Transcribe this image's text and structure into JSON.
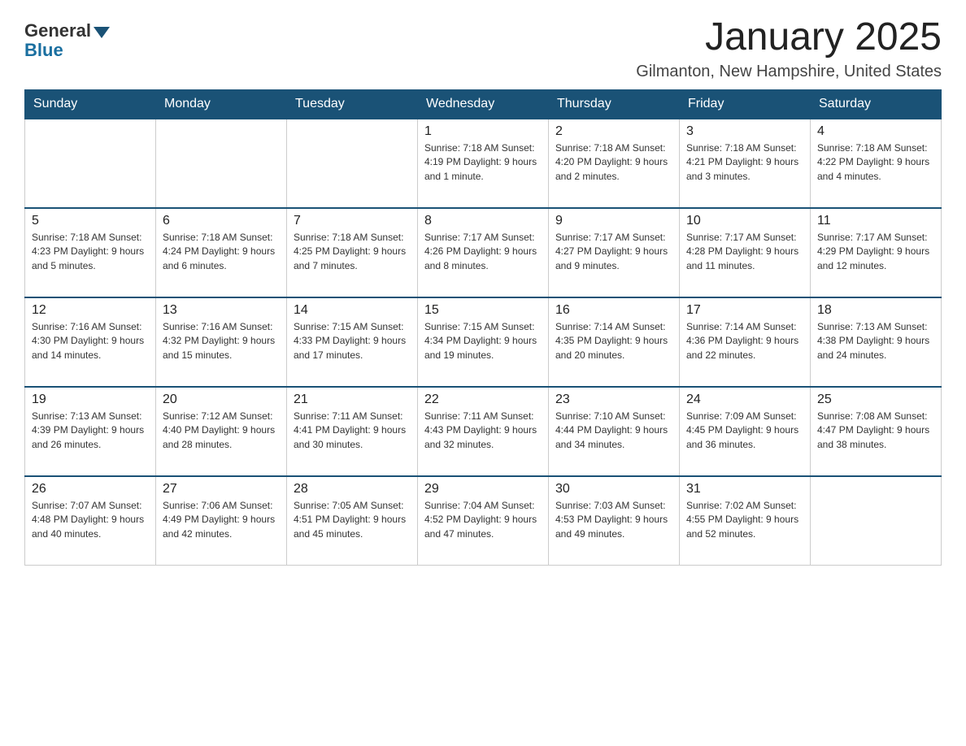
{
  "header": {
    "logo": {
      "general": "General",
      "blue": "Blue"
    },
    "title": "January 2025",
    "location": "Gilmanton, New Hampshire, United States"
  },
  "weekdays": [
    "Sunday",
    "Monday",
    "Tuesday",
    "Wednesday",
    "Thursday",
    "Friday",
    "Saturday"
  ],
  "weeks": [
    [
      {
        "day": "",
        "info": ""
      },
      {
        "day": "",
        "info": ""
      },
      {
        "day": "",
        "info": ""
      },
      {
        "day": "1",
        "info": "Sunrise: 7:18 AM\nSunset: 4:19 PM\nDaylight: 9 hours and 1 minute."
      },
      {
        "day": "2",
        "info": "Sunrise: 7:18 AM\nSunset: 4:20 PM\nDaylight: 9 hours and 2 minutes."
      },
      {
        "day": "3",
        "info": "Sunrise: 7:18 AM\nSunset: 4:21 PM\nDaylight: 9 hours and 3 minutes."
      },
      {
        "day": "4",
        "info": "Sunrise: 7:18 AM\nSunset: 4:22 PM\nDaylight: 9 hours and 4 minutes."
      }
    ],
    [
      {
        "day": "5",
        "info": "Sunrise: 7:18 AM\nSunset: 4:23 PM\nDaylight: 9 hours and 5 minutes."
      },
      {
        "day": "6",
        "info": "Sunrise: 7:18 AM\nSunset: 4:24 PM\nDaylight: 9 hours and 6 minutes."
      },
      {
        "day": "7",
        "info": "Sunrise: 7:18 AM\nSunset: 4:25 PM\nDaylight: 9 hours and 7 minutes."
      },
      {
        "day": "8",
        "info": "Sunrise: 7:17 AM\nSunset: 4:26 PM\nDaylight: 9 hours and 8 minutes."
      },
      {
        "day": "9",
        "info": "Sunrise: 7:17 AM\nSunset: 4:27 PM\nDaylight: 9 hours and 9 minutes."
      },
      {
        "day": "10",
        "info": "Sunrise: 7:17 AM\nSunset: 4:28 PM\nDaylight: 9 hours and 11 minutes."
      },
      {
        "day": "11",
        "info": "Sunrise: 7:17 AM\nSunset: 4:29 PM\nDaylight: 9 hours and 12 minutes."
      }
    ],
    [
      {
        "day": "12",
        "info": "Sunrise: 7:16 AM\nSunset: 4:30 PM\nDaylight: 9 hours and 14 minutes."
      },
      {
        "day": "13",
        "info": "Sunrise: 7:16 AM\nSunset: 4:32 PM\nDaylight: 9 hours and 15 minutes."
      },
      {
        "day": "14",
        "info": "Sunrise: 7:15 AM\nSunset: 4:33 PM\nDaylight: 9 hours and 17 minutes."
      },
      {
        "day": "15",
        "info": "Sunrise: 7:15 AM\nSunset: 4:34 PM\nDaylight: 9 hours and 19 minutes."
      },
      {
        "day": "16",
        "info": "Sunrise: 7:14 AM\nSunset: 4:35 PM\nDaylight: 9 hours and 20 minutes."
      },
      {
        "day": "17",
        "info": "Sunrise: 7:14 AM\nSunset: 4:36 PM\nDaylight: 9 hours and 22 minutes."
      },
      {
        "day": "18",
        "info": "Sunrise: 7:13 AM\nSunset: 4:38 PM\nDaylight: 9 hours and 24 minutes."
      }
    ],
    [
      {
        "day": "19",
        "info": "Sunrise: 7:13 AM\nSunset: 4:39 PM\nDaylight: 9 hours and 26 minutes."
      },
      {
        "day": "20",
        "info": "Sunrise: 7:12 AM\nSunset: 4:40 PM\nDaylight: 9 hours and 28 minutes."
      },
      {
        "day": "21",
        "info": "Sunrise: 7:11 AM\nSunset: 4:41 PM\nDaylight: 9 hours and 30 minutes."
      },
      {
        "day": "22",
        "info": "Sunrise: 7:11 AM\nSunset: 4:43 PM\nDaylight: 9 hours and 32 minutes."
      },
      {
        "day": "23",
        "info": "Sunrise: 7:10 AM\nSunset: 4:44 PM\nDaylight: 9 hours and 34 minutes."
      },
      {
        "day": "24",
        "info": "Sunrise: 7:09 AM\nSunset: 4:45 PM\nDaylight: 9 hours and 36 minutes."
      },
      {
        "day": "25",
        "info": "Sunrise: 7:08 AM\nSunset: 4:47 PM\nDaylight: 9 hours and 38 minutes."
      }
    ],
    [
      {
        "day": "26",
        "info": "Sunrise: 7:07 AM\nSunset: 4:48 PM\nDaylight: 9 hours and 40 minutes."
      },
      {
        "day": "27",
        "info": "Sunrise: 7:06 AM\nSunset: 4:49 PM\nDaylight: 9 hours and 42 minutes."
      },
      {
        "day": "28",
        "info": "Sunrise: 7:05 AM\nSunset: 4:51 PM\nDaylight: 9 hours and 45 minutes."
      },
      {
        "day": "29",
        "info": "Sunrise: 7:04 AM\nSunset: 4:52 PM\nDaylight: 9 hours and 47 minutes."
      },
      {
        "day": "30",
        "info": "Sunrise: 7:03 AM\nSunset: 4:53 PM\nDaylight: 9 hours and 49 minutes."
      },
      {
        "day": "31",
        "info": "Sunrise: 7:02 AM\nSunset: 4:55 PM\nDaylight: 9 hours and 52 minutes."
      },
      {
        "day": "",
        "info": ""
      }
    ]
  ]
}
